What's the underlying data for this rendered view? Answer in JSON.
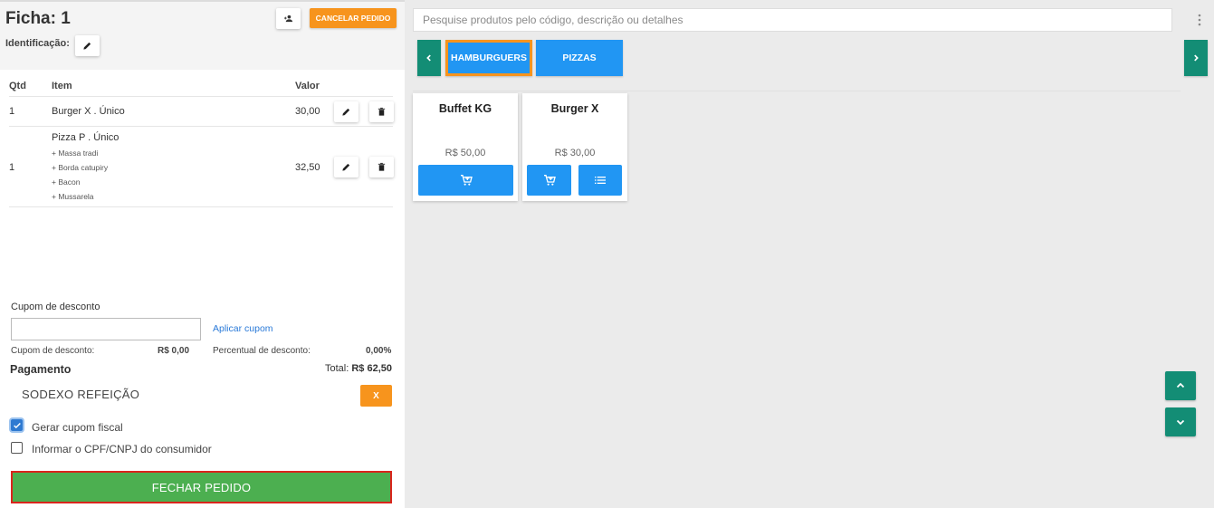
{
  "order": {
    "title": "Ficha: 1",
    "identification_label": "Identificação:",
    "cancel_label": "CANCELAR PEDIDO",
    "table": {
      "headers": {
        "qty": "Qtd",
        "item": "Item",
        "value": "Valor"
      },
      "rows": [
        {
          "qty": "1",
          "item": "Burger X . Único",
          "value": "30,00",
          "extras": []
        },
        {
          "qty": "1",
          "item": "Pizza P . Único",
          "value": "32,50",
          "extras": [
            "+ Massa tradi",
            "+ Borda catupiry",
            "+ Bacon",
            "+ Mussarela"
          ]
        }
      ]
    }
  },
  "coupon": {
    "label": "Cupom de desconto",
    "input_value": "",
    "apply_label": "Aplicar cupom",
    "discount_label": "Cupom de desconto:",
    "discount_value": "R$ 0,00",
    "percent_label": "Percentual de desconto:",
    "percent_value": "0,00%"
  },
  "payment": {
    "title": "Pagamento",
    "total_label": "Total:",
    "total_value": "R$ 62,50",
    "method": "SODEXO REFEIÇÃO",
    "remove_label": "X"
  },
  "options": {
    "fiscal_label": "Gerar cupom fiscal",
    "fiscal_checked": true,
    "cpf_label": "Informar o CPF/CNPJ do consumidor",
    "cpf_checked": false
  },
  "close_label": "FECHAR PEDIDO",
  "catalog": {
    "search_placeholder": "Pesquise produtos pelo código, descrição ou detalhes",
    "categories": [
      {
        "label": "HAMBURGUERS",
        "active": true
      },
      {
        "label": "PIZZAS",
        "active": false
      }
    ],
    "products": [
      {
        "name": "Buffet KG",
        "price": "R$ 50,00"
      },
      {
        "name": "Burger X",
        "price": "R$ 30,00"
      }
    ]
  },
  "colors": {
    "accent_orange": "#f7941d",
    "primary_blue": "#2196f3",
    "teal": "#138d75",
    "success_green": "#4caf50",
    "alert_red": "#d9251c"
  },
  "icons": {
    "add_customer": "person-add-icon",
    "edit": "pencil-icon",
    "delete": "trash-icon",
    "cart": "add-cart-icon",
    "details": "list-icon",
    "menu": "vertical-dots-icon"
  }
}
